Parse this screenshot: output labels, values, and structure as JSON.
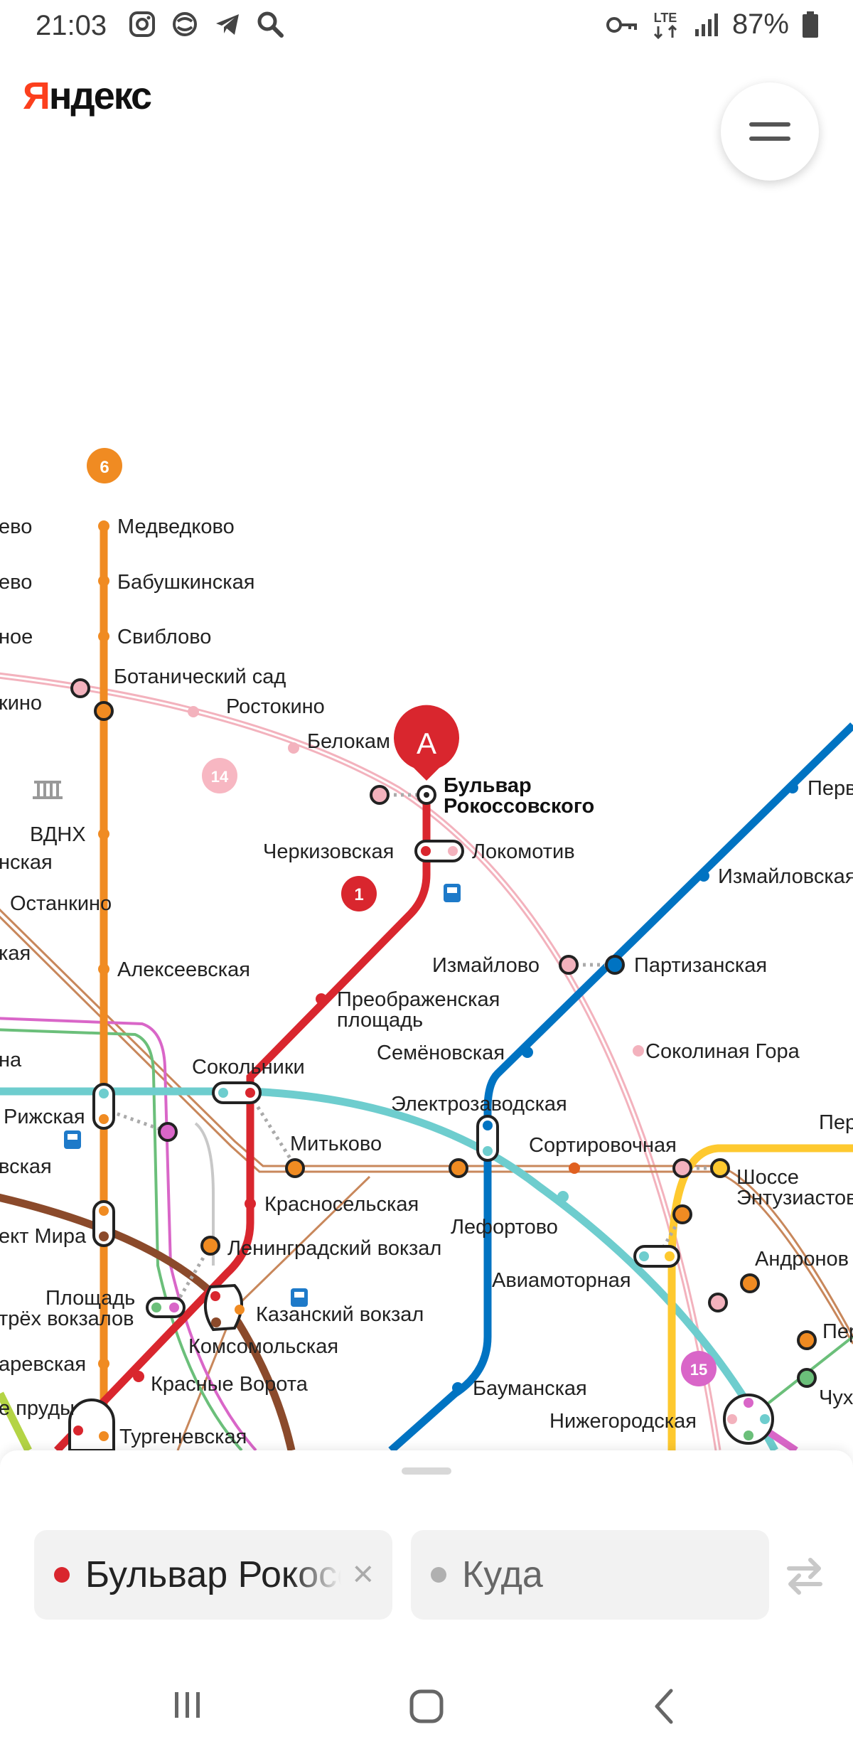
{
  "status_bar": {
    "time": "21:03",
    "network": "LTE",
    "battery": "87%",
    "left_icons": [
      "instagram-icon",
      "sync-icon",
      "telegram-icon",
      "search-icon"
    ],
    "right_icons": [
      "key-icon",
      "lte-icon",
      "signal-icon",
      "battery-icon"
    ]
  },
  "header": {
    "logo_first": "Я",
    "logo_rest": "ндекс",
    "menu_icon": "hamburger-icon"
  },
  "map": {
    "marker_label": "A",
    "line_badges": {
      "orange": "6",
      "pink": "14",
      "red": "1",
      "magenta": "15"
    },
    "colors": {
      "red": "#d9262e",
      "orange": "#f08b22",
      "blue": "#0073c2",
      "teal": "#6ecdce",
      "brown": "#8b4a2b",
      "pink": "#f3b2bd",
      "yellow": "#fec92f",
      "green": "#55b040",
      "magenta": "#d966c8"
    },
    "stations": {
      "medvedkovo_partial": "ево",
      "medvedkovo": "Медведково",
      "babushkinskaya_left": "ево",
      "babushkinskaya": "Бабушкинская",
      "sviblovo_left": "ное",
      "sviblovo": "Свиблово",
      "botanichesky": "Ботанический сад",
      "rostokino_left": "кино",
      "rostokino": "Ростокино",
      "belokamennaya": "Белокам",
      "bulvar_1": "Бульвар",
      "bulvar_2": "Рокоссовского",
      "vdnh": "ВДНХ",
      "nskaya": "нская",
      "ostankino": "Останкино",
      "kaya": "кая",
      "cherkizovskaya": "Черкизовская",
      "lokomotiv": "Локомотив",
      "pervomaiskaya": "Перв",
      "izmailovskaya": "Измайловская",
      "izmailovo": "Измайлово",
      "partizanskaya": "Партизанская",
      "alekseevskaya": "Алексеевская",
      "preobrazhenskaya_1": "Преображенская",
      "preobrazhenskaya_2": "площадь",
      "na": "на",
      "semenovskaya": "Семёновская",
      "sokolinaya": "Соколиная Гора",
      "sokolniki": "Сокольники",
      "rizhskaya": "Рижская",
      "elektrozavodskaya": "Электрозаводская",
      "per_right": "Пер",
      "vskaya": "вская",
      "mitkovo": "Митьково",
      "sortirovochnaya": "Сортировочная",
      "shosse_1": "Шоссе",
      "shosse_2": "Энтузиастов",
      "krasnoselskaya": "Красносельская",
      "prospekt_mira": "ект Мира",
      "lefortovo": "Лефортово",
      "andronovka": "Андронов",
      "leningradsky": "Ленинградский вокзал",
      "aviamotornaya": "Авиамоторная",
      "ploshchad": "Площадь",
      "tryokh": "трёх вокзалов",
      "kazansky": "Казанский вокзал",
      "per_right2": "Пер",
      "komsomolskaya": "Комсомольская",
      "tsaryovskaya": "аревская",
      "krasnye_vorota": "Красные Ворота",
      "baumanskaya": "Бауманская",
      "chuh": "Чух",
      "prudy": "е пруды",
      "nizhegorodskaya": "Нижегородская",
      "turgenevskaya": "Тургеневская"
    }
  },
  "route_panel": {
    "from_value": "Бульвар Рокоссовского",
    "to_placeholder": "Куда",
    "clear_label": "×"
  },
  "nav_bar": {
    "icons": [
      "recent-apps-icon",
      "home-icon",
      "back-icon"
    ]
  }
}
